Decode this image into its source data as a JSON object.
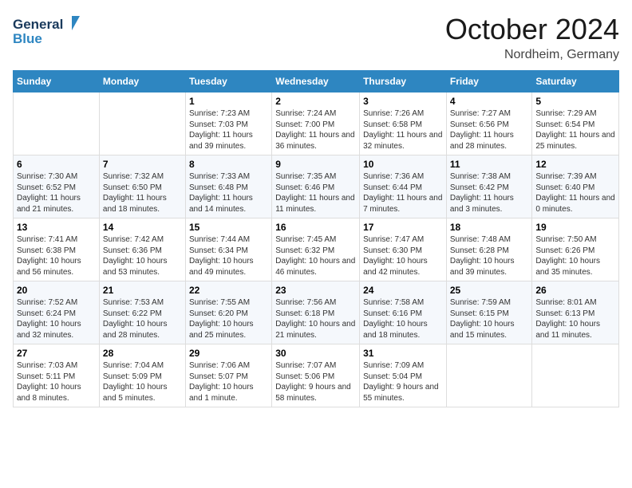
{
  "header": {
    "logo_line1": "General",
    "logo_line2": "Blue",
    "month": "October 2024",
    "location": "Nordheim, Germany"
  },
  "weekdays": [
    "Sunday",
    "Monday",
    "Tuesday",
    "Wednesday",
    "Thursday",
    "Friday",
    "Saturday"
  ],
  "weeks": [
    [
      {
        "day": "",
        "sunrise": "",
        "sunset": "",
        "daylight": ""
      },
      {
        "day": "",
        "sunrise": "",
        "sunset": "",
        "daylight": ""
      },
      {
        "day": "1",
        "sunrise": "Sunrise: 7:23 AM",
        "sunset": "Sunset: 7:03 PM",
        "daylight": "Daylight: 11 hours and 39 minutes."
      },
      {
        "day": "2",
        "sunrise": "Sunrise: 7:24 AM",
        "sunset": "Sunset: 7:00 PM",
        "daylight": "Daylight: 11 hours and 36 minutes."
      },
      {
        "day": "3",
        "sunrise": "Sunrise: 7:26 AM",
        "sunset": "Sunset: 6:58 PM",
        "daylight": "Daylight: 11 hours and 32 minutes."
      },
      {
        "day": "4",
        "sunrise": "Sunrise: 7:27 AM",
        "sunset": "Sunset: 6:56 PM",
        "daylight": "Daylight: 11 hours and 28 minutes."
      },
      {
        "day": "5",
        "sunrise": "Sunrise: 7:29 AM",
        "sunset": "Sunset: 6:54 PM",
        "daylight": "Daylight: 11 hours and 25 minutes."
      }
    ],
    [
      {
        "day": "6",
        "sunrise": "Sunrise: 7:30 AM",
        "sunset": "Sunset: 6:52 PM",
        "daylight": "Daylight: 11 hours and 21 minutes."
      },
      {
        "day": "7",
        "sunrise": "Sunrise: 7:32 AM",
        "sunset": "Sunset: 6:50 PM",
        "daylight": "Daylight: 11 hours and 18 minutes."
      },
      {
        "day": "8",
        "sunrise": "Sunrise: 7:33 AM",
        "sunset": "Sunset: 6:48 PM",
        "daylight": "Daylight: 11 hours and 14 minutes."
      },
      {
        "day": "9",
        "sunrise": "Sunrise: 7:35 AM",
        "sunset": "Sunset: 6:46 PM",
        "daylight": "Daylight: 11 hours and 11 minutes."
      },
      {
        "day": "10",
        "sunrise": "Sunrise: 7:36 AM",
        "sunset": "Sunset: 6:44 PM",
        "daylight": "Daylight: 11 hours and 7 minutes."
      },
      {
        "day": "11",
        "sunrise": "Sunrise: 7:38 AM",
        "sunset": "Sunset: 6:42 PM",
        "daylight": "Daylight: 11 hours and 3 minutes."
      },
      {
        "day": "12",
        "sunrise": "Sunrise: 7:39 AM",
        "sunset": "Sunset: 6:40 PM",
        "daylight": "Daylight: 11 hours and 0 minutes."
      }
    ],
    [
      {
        "day": "13",
        "sunrise": "Sunrise: 7:41 AM",
        "sunset": "Sunset: 6:38 PM",
        "daylight": "Daylight: 10 hours and 56 minutes."
      },
      {
        "day": "14",
        "sunrise": "Sunrise: 7:42 AM",
        "sunset": "Sunset: 6:36 PM",
        "daylight": "Daylight: 10 hours and 53 minutes."
      },
      {
        "day": "15",
        "sunrise": "Sunrise: 7:44 AM",
        "sunset": "Sunset: 6:34 PM",
        "daylight": "Daylight: 10 hours and 49 minutes."
      },
      {
        "day": "16",
        "sunrise": "Sunrise: 7:45 AM",
        "sunset": "Sunset: 6:32 PM",
        "daylight": "Daylight: 10 hours and 46 minutes."
      },
      {
        "day": "17",
        "sunrise": "Sunrise: 7:47 AM",
        "sunset": "Sunset: 6:30 PM",
        "daylight": "Daylight: 10 hours and 42 minutes."
      },
      {
        "day": "18",
        "sunrise": "Sunrise: 7:48 AM",
        "sunset": "Sunset: 6:28 PM",
        "daylight": "Daylight: 10 hours and 39 minutes."
      },
      {
        "day": "19",
        "sunrise": "Sunrise: 7:50 AM",
        "sunset": "Sunset: 6:26 PM",
        "daylight": "Daylight: 10 hours and 35 minutes."
      }
    ],
    [
      {
        "day": "20",
        "sunrise": "Sunrise: 7:52 AM",
        "sunset": "Sunset: 6:24 PM",
        "daylight": "Daylight: 10 hours and 32 minutes."
      },
      {
        "day": "21",
        "sunrise": "Sunrise: 7:53 AM",
        "sunset": "Sunset: 6:22 PM",
        "daylight": "Daylight: 10 hours and 28 minutes."
      },
      {
        "day": "22",
        "sunrise": "Sunrise: 7:55 AM",
        "sunset": "Sunset: 6:20 PM",
        "daylight": "Daylight: 10 hours and 25 minutes."
      },
      {
        "day": "23",
        "sunrise": "Sunrise: 7:56 AM",
        "sunset": "Sunset: 6:18 PM",
        "daylight": "Daylight: 10 hours and 21 minutes."
      },
      {
        "day": "24",
        "sunrise": "Sunrise: 7:58 AM",
        "sunset": "Sunset: 6:16 PM",
        "daylight": "Daylight: 10 hours and 18 minutes."
      },
      {
        "day": "25",
        "sunrise": "Sunrise: 7:59 AM",
        "sunset": "Sunset: 6:15 PM",
        "daylight": "Daylight: 10 hours and 15 minutes."
      },
      {
        "day": "26",
        "sunrise": "Sunrise: 8:01 AM",
        "sunset": "Sunset: 6:13 PM",
        "daylight": "Daylight: 10 hours and 11 minutes."
      }
    ],
    [
      {
        "day": "27",
        "sunrise": "Sunrise: 7:03 AM",
        "sunset": "Sunset: 5:11 PM",
        "daylight": "Daylight: 10 hours and 8 minutes."
      },
      {
        "day": "28",
        "sunrise": "Sunrise: 7:04 AM",
        "sunset": "Sunset: 5:09 PM",
        "daylight": "Daylight: 10 hours and 5 minutes."
      },
      {
        "day": "29",
        "sunrise": "Sunrise: 7:06 AM",
        "sunset": "Sunset: 5:07 PM",
        "daylight": "Daylight: 10 hours and 1 minute."
      },
      {
        "day": "30",
        "sunrise": "Sunrise: 7:07 AM",
        "sunset": "Sunset: 5:06 PM",
        "daylight": "Daylight: 9 hours and 58 minutes."
      },
      {
        "day": "31",
        "sunrise": "Sunrise: 7:09 AM",
        "sunset": "Sunset: 5:04 PM",
        "daylight": "Daylight: 9 hours and 55 minutes."
      },
      {
        "day": "",
        "sunrise": "",
        "sunset": "",
        "daylight": ""
      },
      {
        "day": "",
        "sunrise": "",
        "sunset": "",
        "daylight": ""
      }
    ]
  ]
}
